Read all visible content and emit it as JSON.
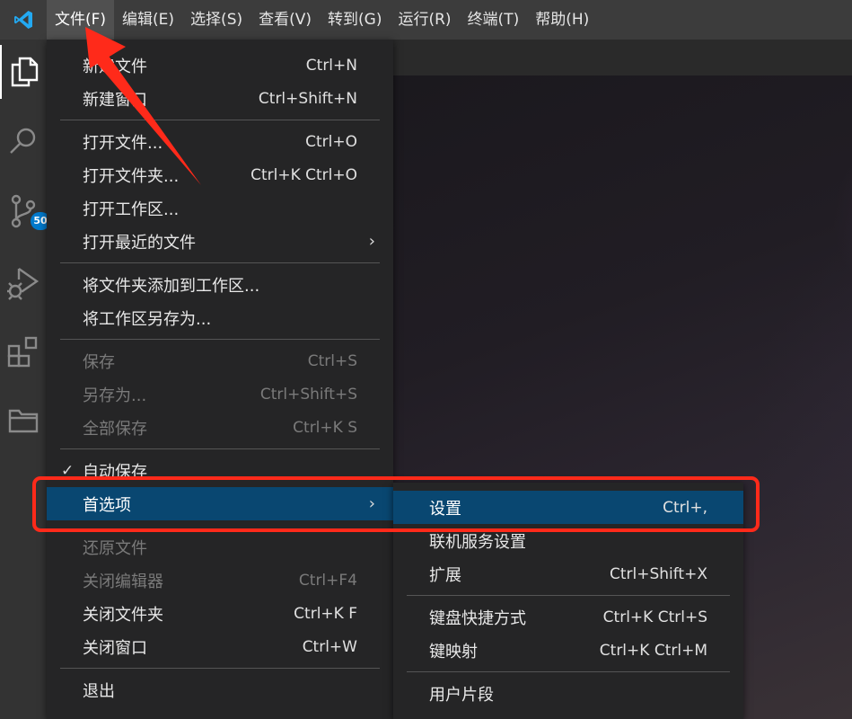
{
  "menubar": {
    "items": [
      "文件(F)",
      "编辑(E)",
      "选择(S)",
      "查看(V)",
      "转到(G)",
      "运行(R)",
      "终端(T)",
      "帮助(H)"
    ],
    "active_index": 0
  },
  "activity_bar": {
    "icons": [
      "explorer-icon",
      "search-icon",
      "source-control-icon",
      "run-debug-icon",
      "extensions-icon",
      "folder-icon"
    ],
    "scm_badge": "50",
    "accent_color": "#007acc"
  },
  "file_menu": {
    "groups": [
      [
        {
          "label": "新建文件",
          "key": "Ctrl+N",
          "enabled": true
        },
        {
          "label": "新建窗口",
          "key": "Ctrl+Shift+N",
          "enabled": true
        }
      ],
      [
        {
          "label": "打开文件...",
          "key": "Ctrl+O",
          "enabled": true
        },
        {
          "label": "打开文件夹...",
          "key": "Ctrl+K Ctrl+O",
          "enabled": true
        },
        {
          "label": "打开工作区...",
          "key": "",
          "enabled": true
        },
        {
          "label": "打开最近的文件",
          "key": "",
          "enabled": true,
          "submenu": true
        }
      ],
      [
        {
          "label": "将文件夹添加到工作区...",
          "key": "",
          "enabled": true
        },
        {
          "label": "将工作区另存为...",
          "key": "",
          "enabled": true
        }
      ],
      [
        {
          "label": "保存",
          "key": "Ctrl+S",
          "enabled": false
        },
        {
          "label": "另存为...",
          "key": "Ctrl+Shift+S",
          "enabled": false
        },
        {
          "label": "全部保存",
          "key": "Ctrl+K S",
          "enabled": false
        }
      ],
      [
        {
          "label": "自动保存",
          "key": "",
          "enabled": true,
          "checked": true
        },
        {
          "label": "首选项",
          "key": "",
          "enabled": true,
          "submenu": true,
          "selected": true
        }
      ],
      [
        {
          "label": "还原文件",
          "key": "",
          "enabled": false
        },
        {
          "label": "关闭编辑器",
          "key": "Ctrl+F4",
          "enabled": false
        },
        {
          "label": "关闭文件夹",
          "key": "Ctrl+K F",
          "enabled": true
        },
        {
          "label": "关闭窗口",
          "key": "Ctrl+W",
          "enabled": true
        }
      ],
      [
        {
          "label": "退出",
          "key": "",
          "enabled": true
        }
      ]
    ]
  },
  "preferences_submenu": {
    "groups": [
      [
        {
          "label": "设置",
          "key": "Ctrl+,",
          "selected": true
        },
        {
          "label": "联机服务设置",
          "key": ""
        },
        {
          "label": "扩展",
          "key": "Ctrl+Shift+X"
        }
      ],
      [
        {
          "label": "键盘快捷方式",
          "key": "Ctrl+K Ctrl+S"
        },
        {
          "label": "键映射",
          "key": "Ctrl+K Ctrl+M"
        }
      ],
      [
        {
          "label": "用户片段",
          "key": ""
        }
      ]
    ]
  },
  "colors": {
    "selection": "#094771",
    "annotation_red": "#ff2a1a"
  }
}
